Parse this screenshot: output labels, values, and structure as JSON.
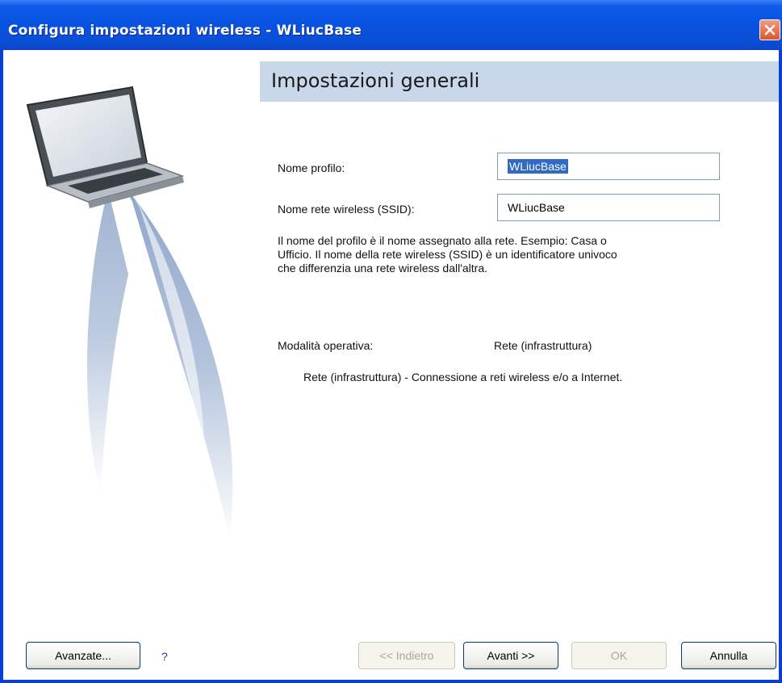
{
  "window": {
    "title": "Configura impostazioni wireless - WLiucBase"
  },
  "header": {
    "title": "Impostazioni generali"
  },
  "form": {
    "profile_name_label": "Nome profilo:",
    "profile_name_value": "WLiucBase",
    "ssid_label": "Nome rete wireless (SSID):",
    "ssid_value": "WLiucBase",
    "description_lines": [
      "Il nome del profilo è il nome assegnato alla rete. Esempio: Casa o",
      "Ufficio. Il nome della rete wireless (SSID) è un identificatore univoco",
      "che differenzia una rete wireless dall'altra."
    ],
    "mode_label": "Modalità operativa:",
    "mode_value": "Rete (infrastruttura)",
    "mode_description": "Rete (infrastruttura) - Connessione a reti wireless e/o a Internet."
  },
  "buttons": {
    "advanced": "Avanzate...",
    "help": "?",
    "back": "<< Indietro",
    "next": "Avanti >>",
    "ok": "OK",
    "cancel": "Annulla"
  },
  "icons": {
    "close": "close-icon",
    "laptop": "laptop-illustration"
  }
}
